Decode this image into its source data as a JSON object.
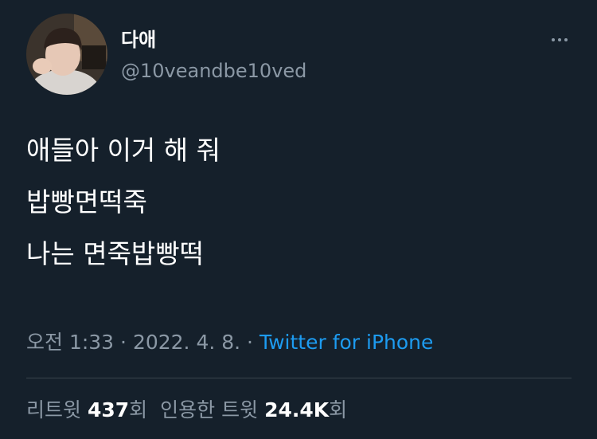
{
  "tweet": {
    "author": {
      "display_name": "다애",
      "handle": "@10veandbe10ved"
    },
    "more_icon": "more-horizontal-icon",
    "lines": [
      "애들아 이거 해 줘",
      "밥빵면떡죽",
      "나는 면죽밥빵떡"
    ],
    "meta": {
      "time": "오전 1:33",
      "sep1": " · ",
      "date": "2022. 4. 8.",
      "sep2": " · ",
      "source": "Twitter for iPhone"
    },
    "stats": {
      "retweets_label": "리트윗 ",
      "retweets_value": "437",
      "retweets_unit": "회",
      "quotes_label": "인용한 트윗 ",
      "quotes_value": "24.4K",
      "quotes_unit": "회"
    },
    "colors": {
      "background": "#15202b",
      "secondary_text": "#8b98a5",
      "link": "#1d9bf0",
      "divider": "#38444d"
    }
  }
}
